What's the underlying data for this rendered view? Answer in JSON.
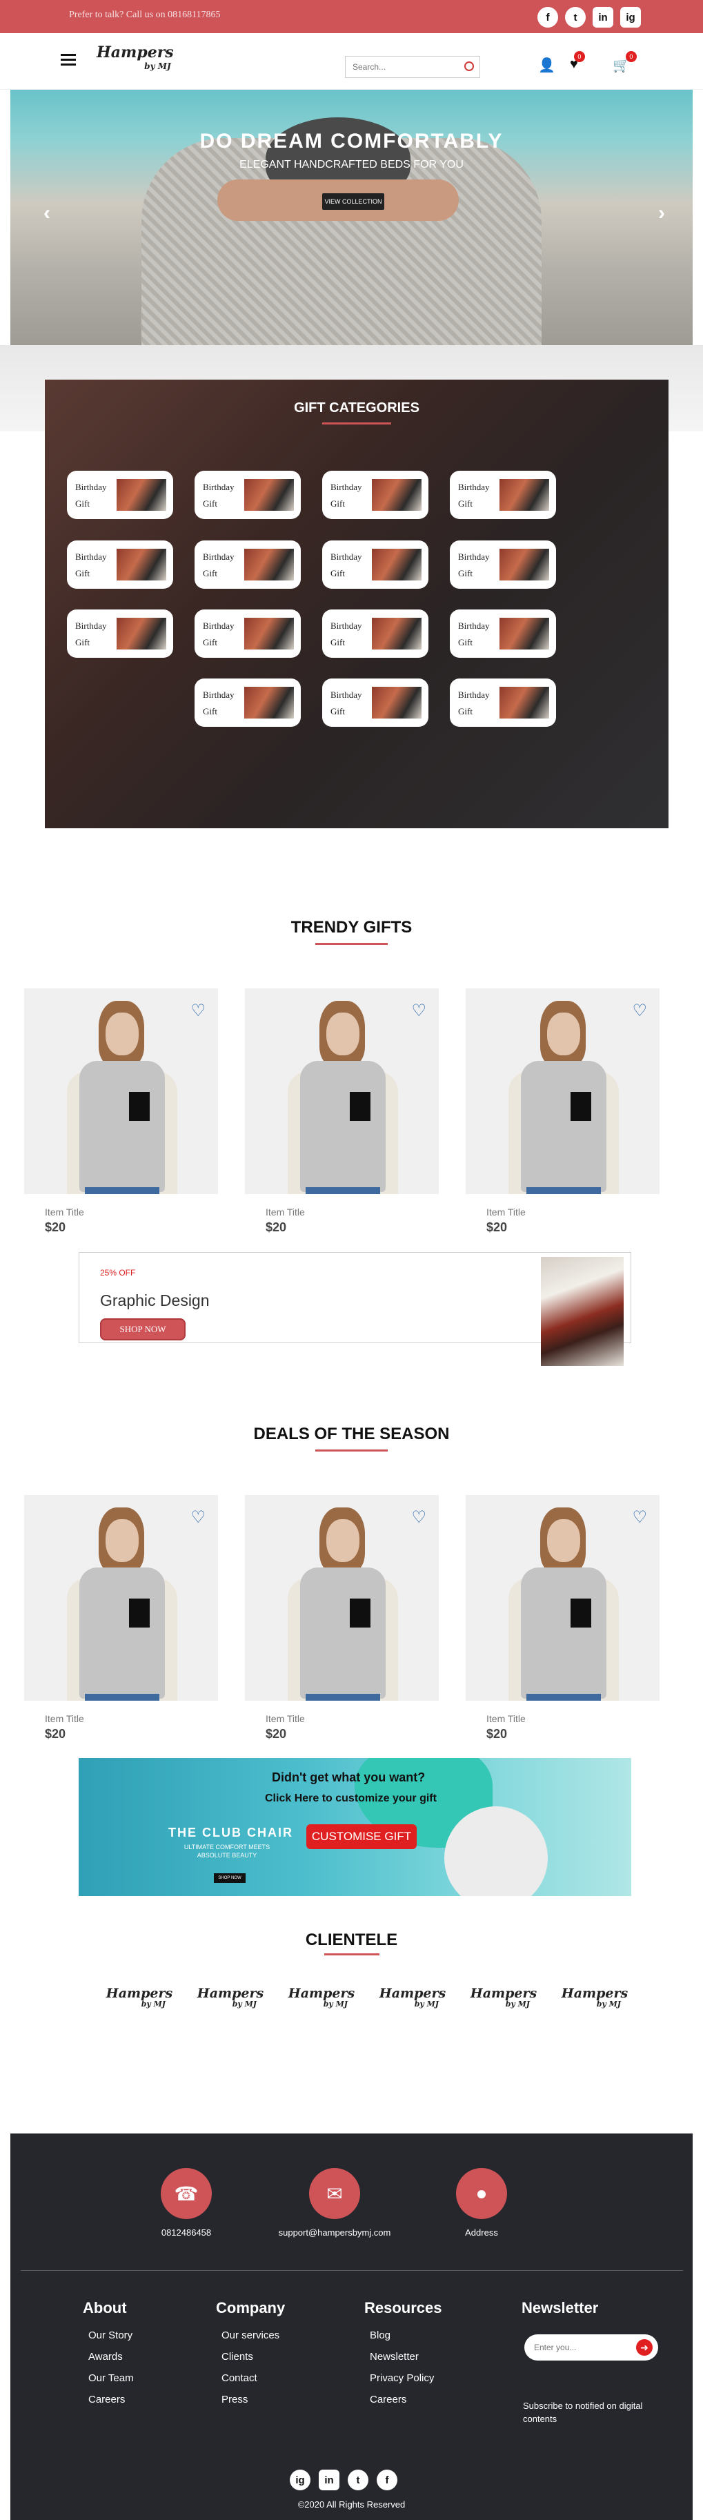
{
  "topbar": {
    "phone_text": "Prefer to talk? Call us on 08168117865",
    "social": [
      "f",
      "t",
      "in",
      "ig"
    ]
  },
  "header": {
    "logo_main": "Hampers",
    "logo_sub": "by MJ",
    "search_placeholder": "Search...",
    "wishlist_count": "0",
    "cart_count": "0"
  },
  "hero": {
    "title": "DO DREAM COMFORTABLY",
    "subtitle": "ELEGANT HANDCRAFTED BEDS FOR YOU",
    "button": "VIEW COLLECTION",
    "prev": "‹",
    "next": "›"
  },
  "gift_categories": {
    "title": "GIFT CATEGORIES",
    "items": [
      {
        "line1": "Birthday",
        "line2": "Gift"
      },
      {
        "line1": "Birthday",
        "line2": "Gift"
      },
      {
        "line1": "Birthday",
        "line2": "Gift"
      },
      {
        "line1": "Birthday",
        "line2": "Gift"
      },
      {
        "line1": "Birthday",
        "line2": "Gift"
      },
      {
        "line1": "Birthday",
        "line2": "Gift"
      },
      {
        "line1": "Birthday",
        "line2": "Gift"
      },
      {
        "line1": "Birthday",
        "line2": "Gift"
      },
      {
        "line1": "Birthday",
        "line2": "Gift"
      },
      {
        "line1": "Birthday",
        "line2": "Gift"
      },
      {
        "line1": "Birthday",
        "line2": "Gift"
      },
      {
        "line1": "Birthday",
        "line2": "Gift"
      },
      {
        "line1": "Birthday",
        "line2": "Gift"
      },
      {
        "line1": "Birthday",
        "line2": "Gift"
      },
      {
        "line1": "Birthday",
        "line2": "Gift"
      }
    ]
  },
  "trendy": {
    "title": "TRENDY GIFTS",
    "products": [
      {
        "title": "Item Title",
        "price": "$20"
      },
      {
        "title": "Item Title",
        "price": "$20"
      },
      {
        "title": "Item Title",
        "price": "$20"
      }
    ]
  },
  "promo": {
    "discount": "25% OFF",
    "name": "Graphic Design",
    "button": "SHOP NOW"
  },
  "deals": {
    "title": "DEALS OF THE SEASON",
    "products": [
      {
        "title": "Item Title",
        "price": "$20"
      },
      {
        "title": "Item Title",
        "price": "$20"
      },
      {
        "title": "Item Title",
        "price": "$20"
      }
    ]
  },
  "club": {
    "question": "Didn't get what you want?",
    "click_here": "Click Here to customize your gift",
    "name": "THE CLUB CHAIR",
    "tagline": "ULTIMATE COMFORT MEETS ABSOLUTE BEAUTY",
    "shop_now": "SHOP NOW",
    "customise": "CUSTOMISE GIFT"
  },
  "clientele": {
    "title": "CLIENTELE",
    "logos": [
      {
        "main": "Hampers",
        "sub": "by MJ"
      },
      {
        "main": "Hampers",
        "sub": "by MJ"
      },
      {
        "main": "Hampers",
        "sub": "by MJ"
      },
      {
        "main": "Hampers",
        "sub": "by MJ"
      },
      {
        "main": "Hampers",
        "sub": "by MJ"
      },
      {
        "main": "Hampers",
        "sub": "by MJ"
      }
    ]
  },
  "footer": {
    "phone": "0812486458",
    "email": "support@hampersbymj.com",
    "address": "Address",
    "about": {
      "title": "About",
      "items": [
        "Our Story",
        "Awards",
        "Our Team",
        "Careers"
      ]
    },
    "company": {
      "title": "Company",
      "items": [
        "Our services",
        "Clients",
        "Contact",
        "Press"
      ]
    },
    "resources": {
      "title": "Resources",
      "items": [
        "Blog",
        "Newsletter",
        "Privacy Policy",
        "Careers"
      ]
    },
    "newsletter": {
      "title": "Newsletter",
      "placeholder": "Enter you...",
      "note": "Subscribe to notified on digital contents"
    },
    "copyright": "©2020 All Rights Reserved"
  },
  "colors": {
    "accent": "#cf5458",
    "footer_bg": "#25272c",
    "heart": "#1f5fa8"
  }
}
